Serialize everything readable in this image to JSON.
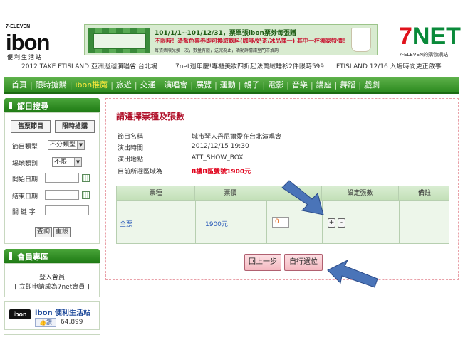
{
  "header": {
    "ibon_logo": {
      "tag": "7-ELEVEN",
      "brand": "ibon",
      "sub": "便利生活站"
    },
    "banner": {
      "line1": "101/1/1~101/12/31，票單張ibon票券每張贈",
      "line2": "不限時！憑藍色票券即可換取飲料(咖啡/奶茶/冰品擇一) 其中一杯獨家特價！",
      "line3": "每張票限兌換一次，數量有限，送完為止，活動詳情請至門市洽詢"
    },
    "net_logo": {
      "brand_a": "7",
      "brand_b": "NET",
      "caption": "7-ELEVEN的購物網站"
    },
    "ticker": [
      "2012 TAKE FTISLAND 亞洲巡迴演唱會 台北場",
      "7net週年慶!專櫃美妝四折起法蘭絨睡衫2件限時599",
      "FTISLAND 12/16 入場時間更正啟事"
    ]
  },
  "nav": {
    "items": [
      "首頁",
      "限時搶購",
      "ibon推薦",
      "旅遊",
      "交通",
      "演唱會",
      "展覽",
      "運動",
      "親子",
      "電影",
      "音樂",
      "講座",
      "舞蹈",
      "戲劇"
    ],
    "active_index": 2
  },
  "sidebar": {
    "search_title": "節目搜尋",
    "tabs": [
      "售票節目",
      "限時搶購"
    ],
    "fields": {
      "category_label": "節目類型",
      "category_value": "不分類型",
      "venue_label": "場地類別",
      "venue_value": "不限",
      "start_label": "開始日期",
      "end_label": "結束日期",
      "keyword_label": "關 鍵 字"
    },
    "query_button": "查詢",
    "reset_button": "重設",
    "member_title": "會員專區",
    "member_login": "登入會員",
    "member_signup": "[ 立即申請成為7net會員 ]",
    "fb": {
      "logo": "ibon",
      "title": "ibon 便利生活站",
      "like": "讚",
      "count": "64,899"
    }
  },
  "main": {
    "title": "請選擇票種及張數",
    "info": [
      {
        "label": "節目名稱",
        "value": "城市琴人丹尼爾愛在台北演唱會"
      },
      {
        "label": "演出時間",
        "value": "2012/12/15 19:30"
      },
      {
        "label": "演出地點",
        "value": "ATT_SHOW_BOX"
      },
      {
        "label": "目前所選區域為",
        "value": "8樓B區雙號1900元"
      }
    ],
    "table": {
      "headers": [
        "票種",
        "票價",
        "",
        "設定張數",
        "備註"
      ],
      "row": {
        "type": "全票",
        "price": "1900元",
        "qty": "0",
        "plus": "+",
        "minus": "-"
      }
    },
    "back_button": "回上一步",
    "choose_seat_button": "自行選位"
  },
  "colors": {
    "brand_green": "#2c8a1e",
    "accent_red": "#b0102a",
    "arrow_blue": "#4a74b8"
  }
}
